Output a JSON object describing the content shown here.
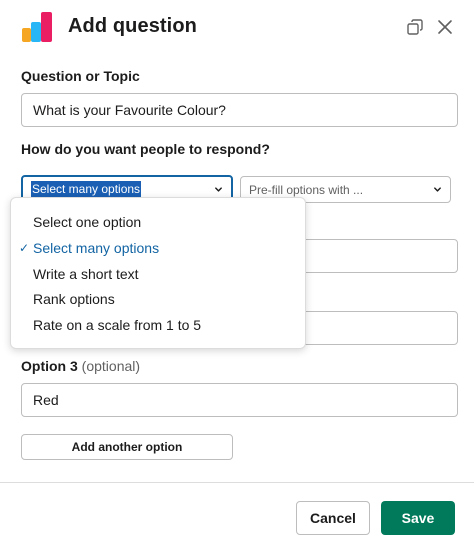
{
  "header": {
    "title": "Add question",
    "icons": [
      "bar-chart-logo",
      "restore-icon",
      "close-icon"
    ]
  },
  "question": {
    "label": "Question or Topic",
    "value": "What is your Favourite Colour?"
  },
  "response": {
    "label": "How do you want people to respond?",
    "selected": "Select many options",
    "prefill_placeholder": "Pre-fill options with ...",
    "options": [
      "Select one option",
      "Select many options",
      "Write a short text",
      "Rank options",
      "Rate on a scale from 1 to 5"
    ],
    "check": "✓"
  },
  "option3": {
    "label": "Option 3",
    "optional": "(optional)",
    "value": "Red"
  },
  "buttons": {
    "add_option": "Add another option",
    "cancel": "Cancel",
    "save": "Save"
  },
  "colors": {
    "accent": "#1264a3",
    "save": "#007a5a",
    "logo": [
      "#f5a623",
      "#29b6f6",
      "#e91e63"
    ]
  }
}
